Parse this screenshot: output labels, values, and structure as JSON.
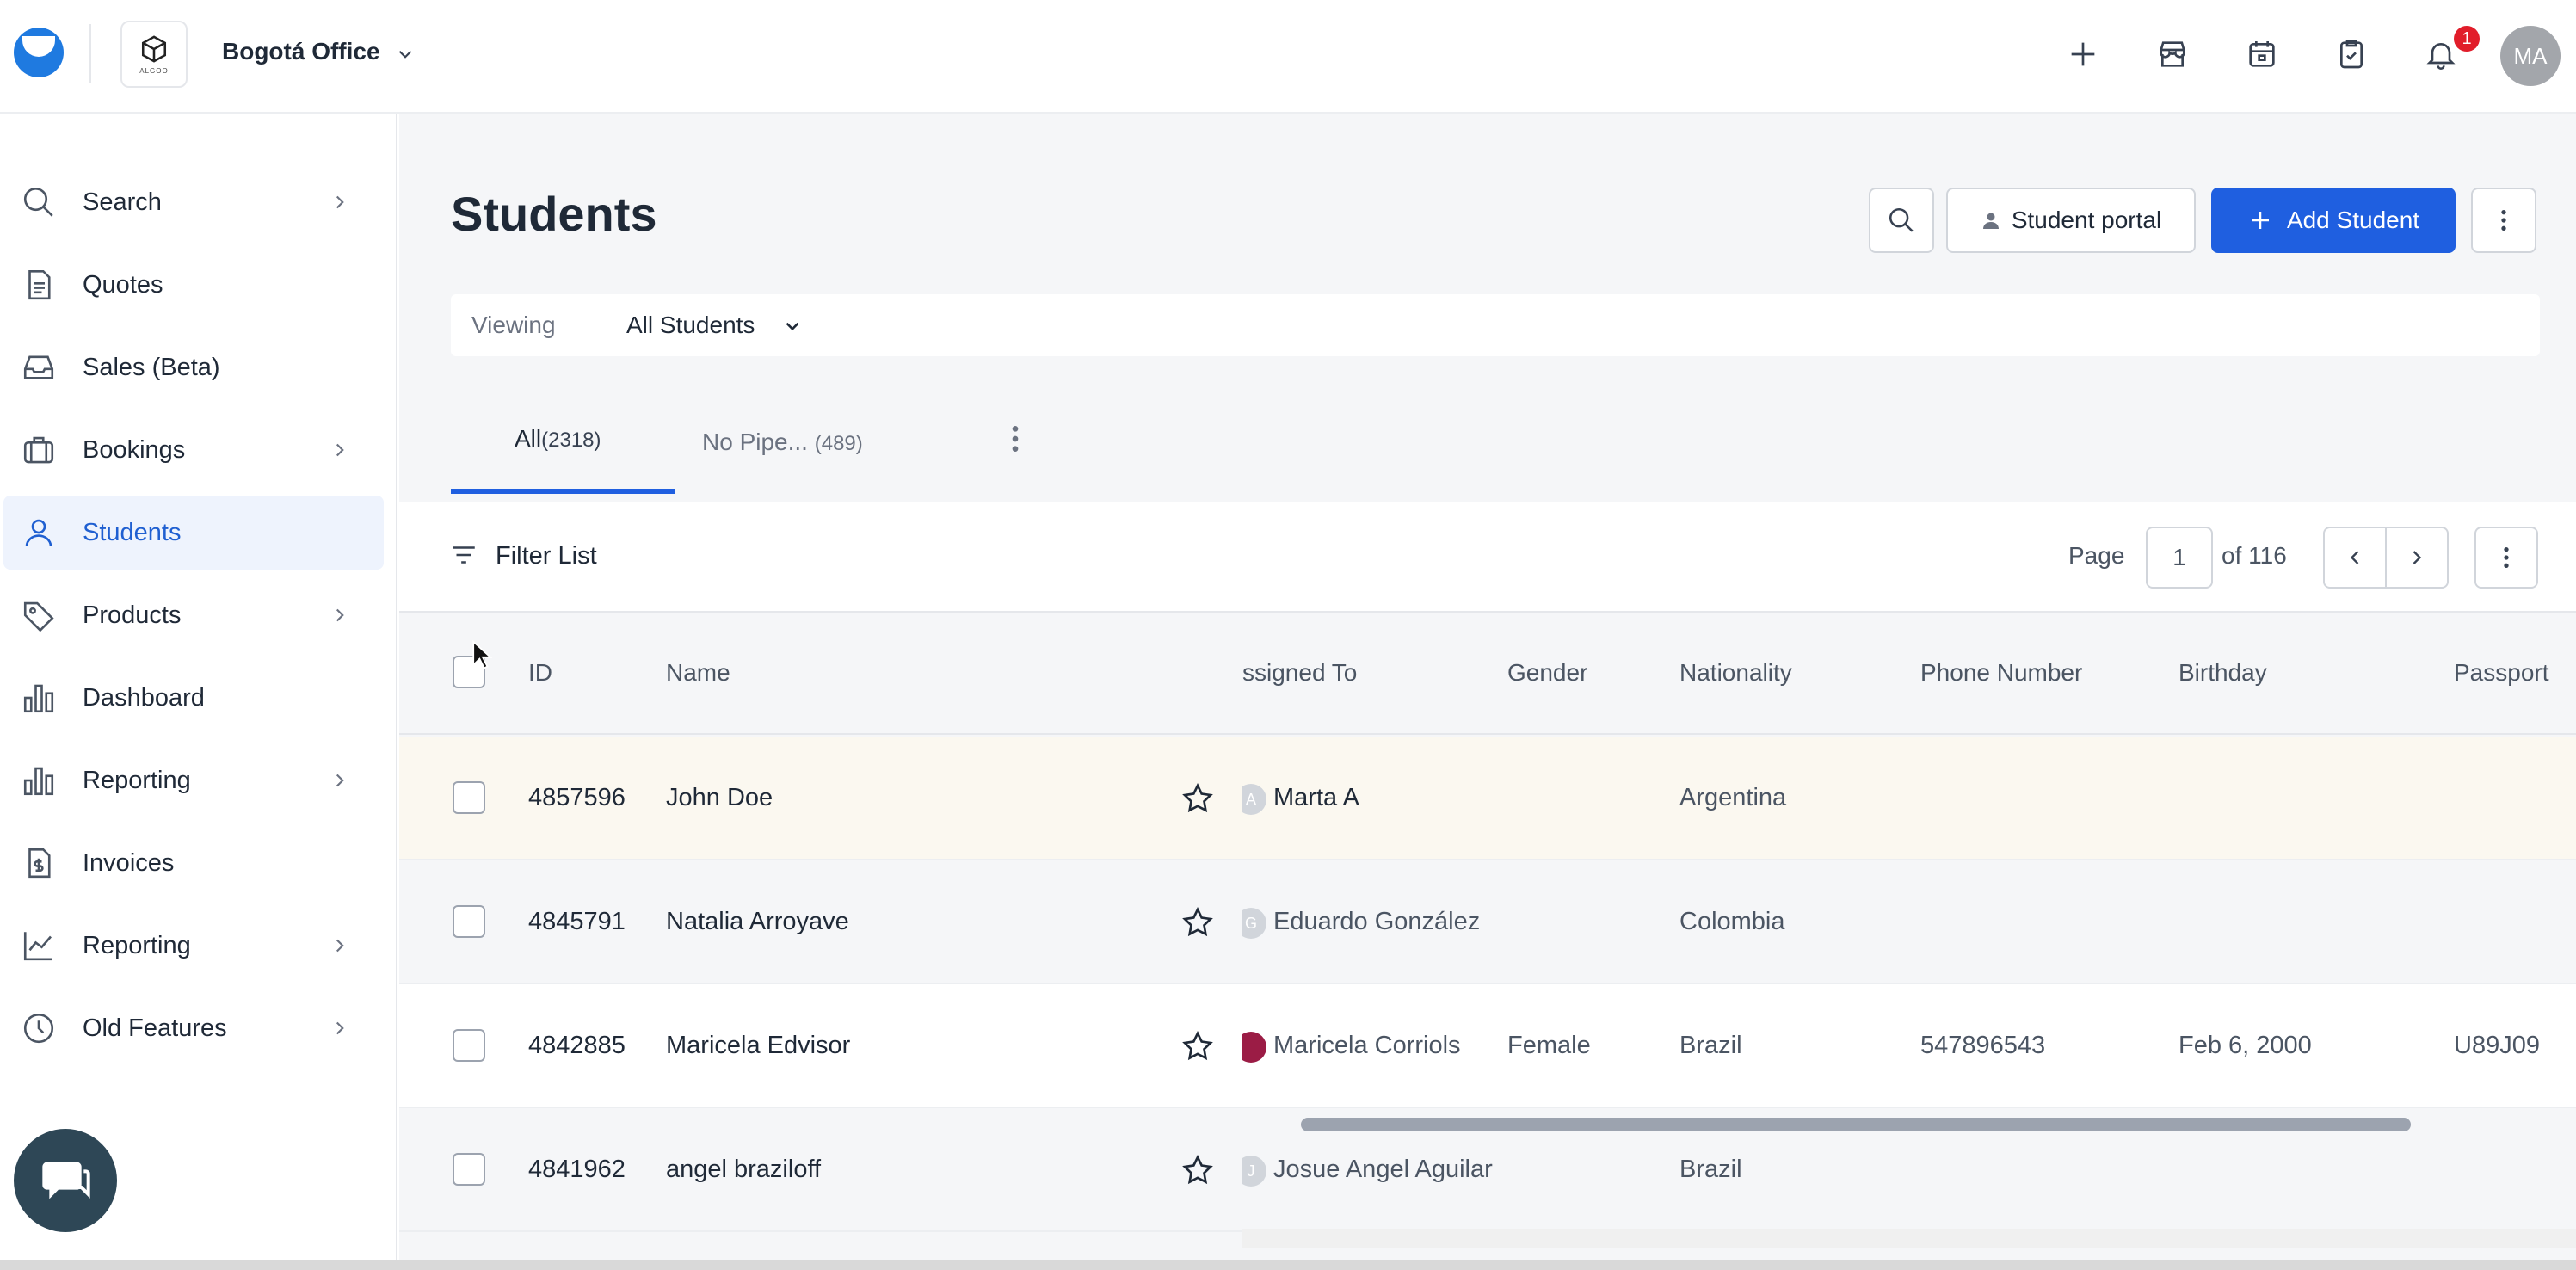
{
  "header": {
    "office_name": "Bogotá Office",
    "office_logo_text": "ALGOO",
    "notifications_count": "1",
    "avatar_initials": "MA",
    "icons": [
      "plus-icon",
      "store-icon",
      "calendar-icon",
      "clipboard-check-icon",
      "bell-icon"
    ]
  },
  "sidebar": {
    "items": [
      {
        "label": "Search",
        "icon": "search-icon",
        "has_chevron": true
      },
      {
        "label": "Quotes",
        "icon": "document-icon",
        "has_chevron": false
      },
      {
        "label": "Sales (Beta)",
        "icon": "inbox-icon",
        "has_chevron": false
      },
      {
        "label": "Bookings",
        "icon": "briefcase-icon",
        "has_chevron": true
      },
      {
        "label": "Students",
        "icon": "user-icon",
        "has_chevron": false,
        "active": true
      },
      {
        "label": "Products",
        "icon": "tag-icon",
        "has_chevron": true
      },
      {
        "label": "Dashboard",
        "icon": "bar-chart-icon",
        "has_chevron": false
      },
      {
        "label": "Reporting",
        "icon": "bar-chart-icon",
        "has_chevron": true
      },
      {
        "label": "Invoices",
        "icon": "invoice-icon",
        "has_chevron": false
      },
      {
        "label": "Reporting",
        "icon": "line-chart-icon",
        "has_chevron": true
      },
      {
        "label": "Old Features",
        "icon": "clock-icon",
        "has_chevron": true
      }
    ]
  },
  "main": {
    "title": "Students",
    "student_portal_label": "Student portal",
    "add_student_label": "Add Student",
    "viewing_label": "Viewing",
    "viewing_value": "All Students",
    "tabs": [
      {
        "label": "All",
        "count": "(2318)",
        "active": true
      },
      {
        "label": "No Pipe...",
        "count": "(489)",
        "active": false
      }
    ],
    "filter_label": "Filter List",
    "pagination": {
      "page_label": "Page",
      "current": "1",
      "of_label": "of 116"
    },
    "columns": [
      "ID",
      "Name",
      "ssigned To",
      "Gender",
      "Nationality",
      "Phone Number",
      "Birthday",
      "Passport"
    ],
    "rows": [
      {
        "id": "4857596",
        "name": "John Doe",
        "assigned": "Marta A",
        "assigned_initial": "A",
        "gender": "",
        "nationality": "Argentina",
        "phone": "",
        "birthday": "",
        "passport": ""
      },
      {
        "id": "4845791",
        "name": "Natalia Arroyave",
        "assigned": "Eduardo González",
        "assigned_initial": "G",
        "gender": "",
        "nationality": "Colombia",
        "phone": "",
        "birthday": "",
        "passport": ""
      },
      {
        "id": "4842885",
        "name": "Maricela Edvisor",
        "assigned": "Maricela Corriols",
        "assigned_initial": "",
        "gender": "Female",
        "nationality": "Brazil",
        "phone": "547896543",
        "birthday": "Feb 6, 2000",
        "passport": "U89J09"
      },
      {
        "id": "4841962",
        "name": "angel braziloff",
        "assigned": "Josue Angel Aguilar",
        "assigned_initial": "J",
        "gender": "",
        "nationality": "Brazil",
        "phone": "",
        "birthday": "",
        "passport": ""
      }
    ]
  },
  "colors": {
    "accent": "#1f5fe0",
    "active_bg": "#eef3fd",
    "badge": "#e11d2a",
    "logo": "#1f7ae0"
  }
}
